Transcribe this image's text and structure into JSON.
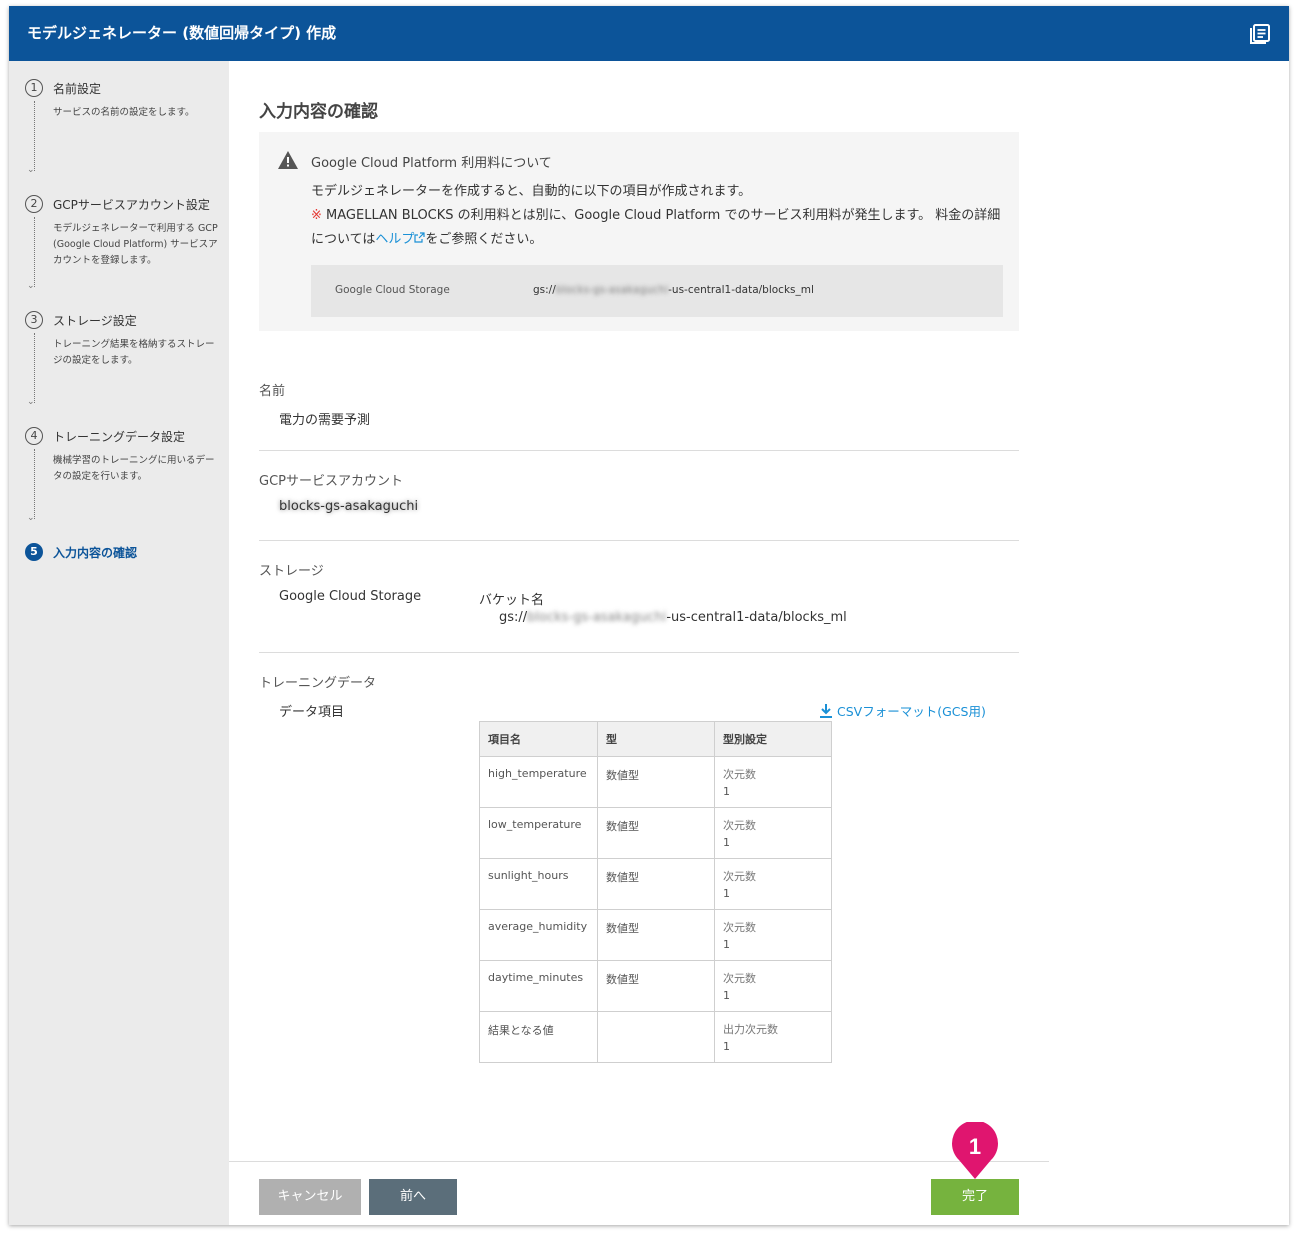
{
  "window": {
    "title": "モデルジェネレーター (数値回帰タイプ) 作成"
  },
  "steps": [
    {
      "number": "1",
      "label": "名前設定",
      "desc": "サービスの名前の設定をします。"
    },
    {
      "number": "2",
      "label": "GCPサービスアカウント設定",
      "desc": "モデルジェネレーターで利用する GCP (Google Cloud Platform) サービスアカウントを登録します。"
    },
    {
      "number": "3",
      "label": "ストレージ設定",
      "desc": "トレーニング結果を格納するストレージの設定をします。"
    },
    {
      "number": "4",
      "label": "トレーニングデータ設定",
      "desc": "機械学習のトレーニングに用いるデータの設定を行います。"
    },
    {
      "number": "5",
      "label": "入力内容の確認",
      "desc": ""
    }
  ],
  "page": {
    "title": "入力内容の確認"
  },
  "notice": {
    "title": "Google Cloud Platform 利用料について",
    "line1": "モデルジェネレーターを作成すると、自動的に以下の項目が作成されます。",
    "mark": "※",
    "line2": " MAGELLAN BLOCKS の利用料とは別に、Google Cloud Platform でのサービス利用料が発生します。 料金の詳細については",
    "help_link": "ヘルプ",
    "line2_end": "をご参照ください。",
    "storage_key": "Google Cloud Storage",
    "storage_prefix": "gs://",
    "storage_blurred": "blocks-gs-asakaguchi",
    "storage_suffix": "-us-central1-data/blocks_ml"
  },
  "name_section": {
    "label": "名前",
    "value": "電力の需要予測"
  },
  "account_section": {
    "label": "GCPサービスアカウント",
    "value_blurred": "blocks-gs-asakaguchi"
  },
  "storage_section": {
    "label": "ストレージ",
    "type": "Google Cloud Storage",
    "bucket_label": "バケット名",
    "bucket_prefix": "gs://",
    "bucket_blurred": "blocks-gs-asakaguchi",
    "bucket_suffix": "-us-central1-data/blocks_ml"
  },
  "training_section": {
    "label": "トレーニングデータ",
    "items_label": "データ項目",
    "csv_link": "CSVフォーマット(GCS用)",
    "columns": [
      "項目名",
      "型",
      "型別設定"
    ],
    "rows": [
      {
        "name": "high_temperature",
        "type": "数値型",
        "setting_label": "次元数",
        "setting_value": "1"
      },
      {
        "name": "low_temperature",
        "type": "数値型",
        "setting_label": "次元数",
        "setting_value": "1"
      },
      {
        "name": "sunlight_hours",
        "type": "数値型",
        "setting_label": "次元数",
        "setting_value": "1"
      },
      {
        "name": "average_humidity",
        "type": "数値型",
        "setting_label": "次元数",
        "setting_value": "1"
      },
      {
        "name": "daytime_minutes",
        "type": "数値型",
        "setting_label": "次元数",
        "setting_value": "1"
      },
      {
        "name": "結果となる値",
        "type": "",
        "setting_label": "出力次元数",
        "setting_value": "1"
      }
    ]
  },
  "buttons": {
    "cancel": "キャンセル",
    "prev": "前へ",
    "done": "完了"
  },
  "marker": {
    "number": "1",
    "color": "#e0156f"
  },
  "colors": {
    "header": "#0c5499",
    "done_button": "#76b33e",
    "link": "#1a90d6"
  },
  "icons": {
    "header": "document-list-icon",
    "notice": "warning-icon",
    "csv": "download-icon",
    "help": "external-link-icon"
  }
}
